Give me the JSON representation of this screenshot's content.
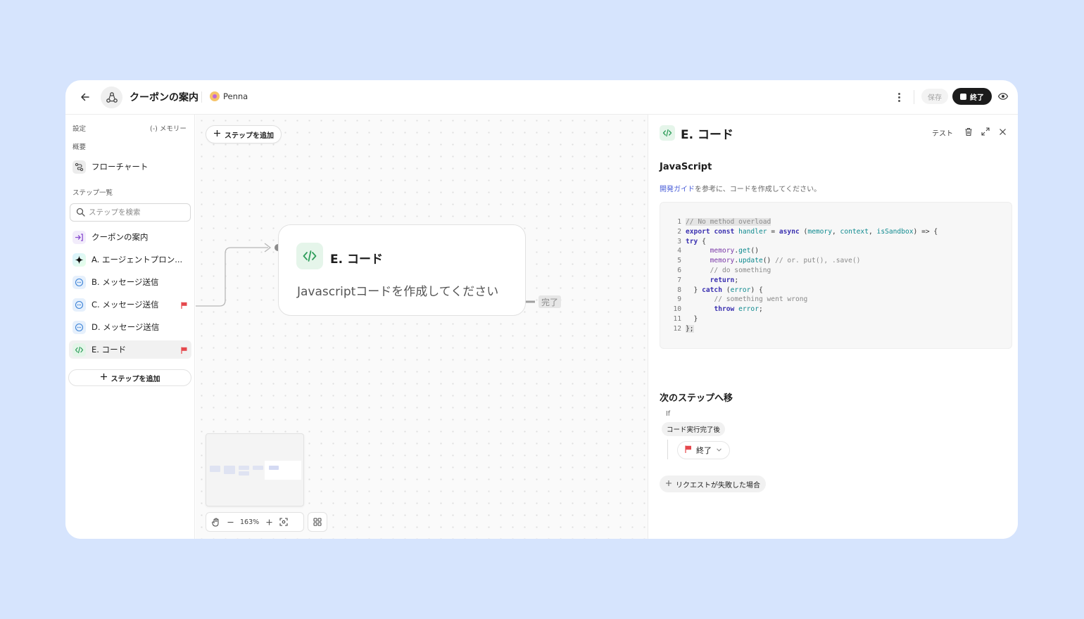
{
  "header": {
    "title": "クーポンの案内",
    "owner": "Penna",
    "save_label": "保存",
    "end_label": "終了"
  },
  "sidebar": {
    "settings_label": "設定",
    "memory_label": "(-) メモリー",
    "overview_label": "概要",
    "flowchart_label": "フローチャート",
    "steps_label": "ステップ一覧",
    "search_placeholder": "ステップを検索",
    "items": [
      {
        "label": "クーポンの案内",
        "icon": "entry-icon",
        "flag": false
      },
      {
        "label": "A. エージェントプロン...",
        "icon": "sparkle-icon",
        "flag": false
      },
      {
        "label": "B. メッセージ送信",
        "icon": "message-icon",
        "flag": false
      },
      {
        "label": "C. メッセージ送信",
        "icon": "message-icon",
        "flag": true
      },
      {
        "label": "D. メッセージ送信",
        "icon": "message-icon",
        "flag": false
      },
      {
        "label": "E. コード",
        "icon": "code-icon",
        "flag": true,
        "active": true
      }
    ],
    "add_step_label": "ステップを追加"
  },
  "canvas": {
    "add_step_label": "ステップを追加",
    "node": {
      "title": "E. コード",
      "description": "Javascriptコードを作成してください"
    },
    "done_label": "完了",
    "zoom": "163%"
  },
  "panel": {
    "title": "E. コード",
    "test_label": "テスト",
    "js_heading": "JavaScript",
    "guide_link": "開発ガイド",
    "guide_text": "を参考に、コードを作成してください。",
    "code_lines": [
      "// No method overload",
      "export const handler = async (memory, context, isSandbox) => {",
      "try {",
      "      memory.get()",
      "      memory.update() // or. put(), .save()",
      "      // do something",
      "      return;",
      "  } catch (error) {",
      "       // something went wrong",
      "       throw error;",
      "  }",
      "};"
    ],
    "next_heading": "次のステップへ移",
    "if_label": "If",
    "condition_label": "コード実行完了後",
    "target_label": "終了",
    "fail_label": "リクエストが失敗した場合"
  },
  "colors": {
    "background": "#d6e4fd",
    "accent_link": "#4b5fd8",
    "flag_red": "#e5484d",
    "code_green": "#2e9d5a"
  }
}
